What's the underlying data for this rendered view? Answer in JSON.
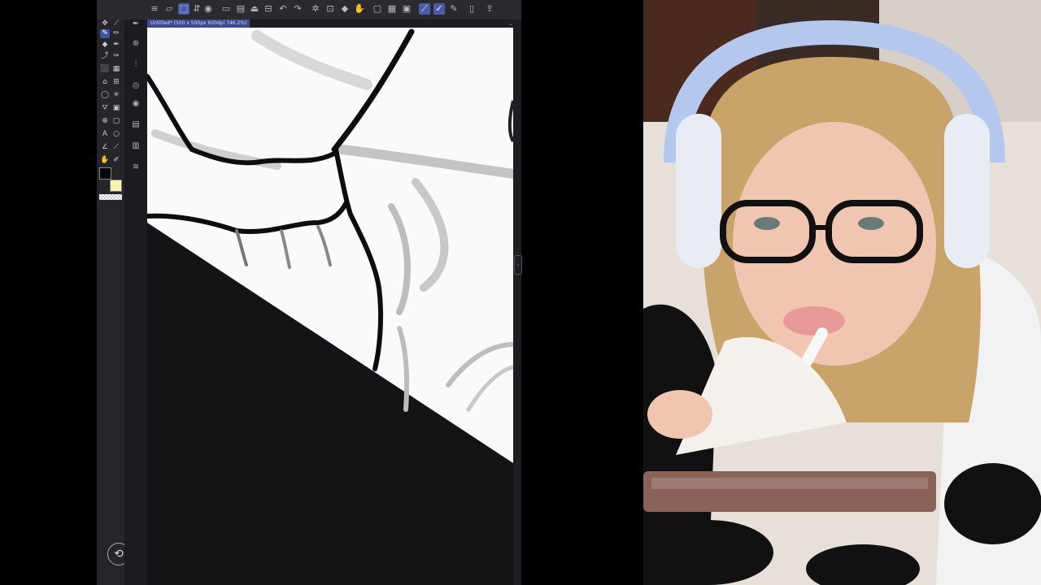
{
  "app": {
    "document_tab": "Untitled* (500 x 500px 600dpi 746.2%)",
    "toolbar_icons": [
      "menu-icon",
      "transform-icon",
      "select-icon",
      "rotate-icon",
      "snapshot-icon",
      "new-file-icon",
      "open-icon",
      "save-icon",
      "layer-icon",
      "undo-icon",
      "redo-icon",
      "settings-icon",
      "fill-icon",
      "crop-icon",
      "hand-icon",
      "ruler-icon",
      "brush-icon",
      "pen-icon",
      "edit-icon",
      "bookmark-icon",
      "share-icon"
    ],
    "tools": [
      "pen",
      "brush",
      "pencil",
      "eraser",
      "marker",
      "airbrush",
      "text",
      "shape",
      "lasso",
      "selection",
      "fill",
      "gradient",
      "magnify",
      "rectangle",
      "hand",
      "eyedropper"
    ],
    "side_icons": [
      "pen-settings-icon",
      "sub-tool-icon",
      "layer-props-icon",
      "navigator-icon",
      "search-icon",
      "layers-icon",
      "materials-icon",
      "stack-icon"
    ],
    "main_color": "#08080c",
    "sub_color": "#fbf3b0"
  },
  "webcam": {
    "description_visible": false
  }
}
